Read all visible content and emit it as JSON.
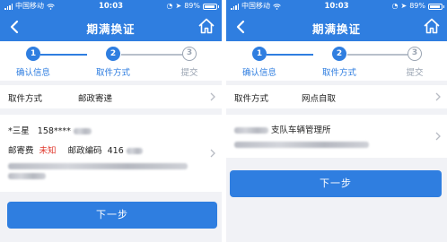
{
  "status_bar": {
    "carrier": "中国移动",
    "time": "10:03",
    "battery": "89%"
  },
  "nav": {
    "title": "期满换证"
  },
  "steps": [
    {
      "num": "1",
      "label": "确认信息"
    },
    {
      "num": "2",
      "label": "取件方式"
    },
    {
      "num": "3",
      "label": "提交"
    }
  ],
  "left": {
    "pickup_row": {
      "label": "取件方式",
      "value": "邮政寄递"
    },
    "address": {
      "name": "*三星",
      "phone": "158****",
      "fee_label": "邮寄费",
      "fee_value": "未知",
      "postcode_label": "邮政编码",
      "postcode_value": "416"
    },
    "next_button": "下一步"
  },
  "right": {
    "pickup_row": {
      "label": "取件方式",
      "value": "网点自取"
    },
    "office": {
      "name_suffix": "支队车辆管理所"
    },
    "next_button": "下一步"
  },
  "colors": {
    "brand": "#2f7ee0",
    "warning": "#e0372c",
    "inactive": "#9aa4b2"
  },
  "icons": [
    "back-arrow-icon",
    "home-icon",
    "chevron-right-icon",
    "wifi-icon",
    "signal-icon",
    "battery-icon",
    "location-icon"
  ]
}
